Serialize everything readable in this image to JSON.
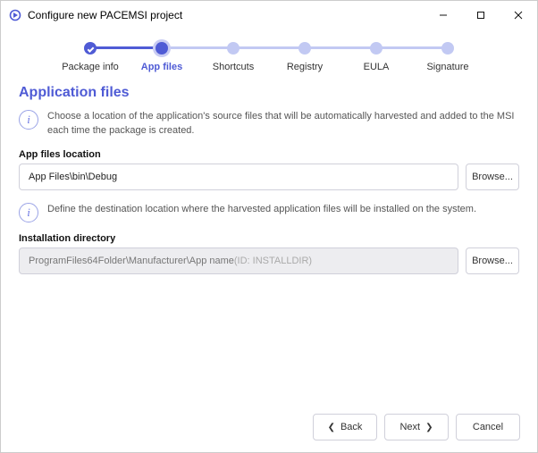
{
  "window": {
    "title": "Configure new PACEMSI project"
  },
  "stepper": {
    "steps": [
      {
        "label": "Package info",
        "state": "done"
      },
      {
        "label": "App files",
        "state": "current"
      },
      {
        "label": "Shortcuts",
        "state": "upcoming"
      },
      {
        "label": "Registry",
        "state": "upcoming"
      },
      {
        "label": "EULA",
        "state": "upcoming"
      },
      {
        "label": "Signature",
        "state": "upcoming"
      }
    ]
  },
  "page": {
    "heading": "Application files",
    "info1": "Choose a location of the application's source files that will be automatically harvested and added to the MSI each time the package is created.",
    "app_files_location_label": "App files location",
    "app_files_location_value": "App Files\\bin\\Debug",
    "browse1": "Browse...",
    "info2": "Define the destination location where the harvested application files will be installed on the system.",
    "install_dir_label": "Installation directory",
    "install_dir_value": "ProgramFiles64Folder\\Manufacturer\\App name",
    "install_dir_hint": "  (ID: INSTALLDIR)",
    "browse2": "Browse..."
  },
  "footer": {
    "back": "Back",
    "next": "Next",
    "cancel": "Cancel"
  }
}
